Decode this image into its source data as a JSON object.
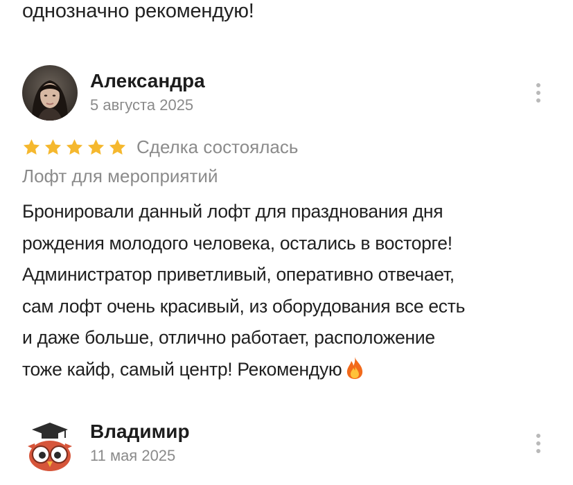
{
  "previous_review": {
    "tail_text": "однозначно рекомендую!"
  },
  "reviews": [
    {
      "author": "Александра",
      "date": "5 августа 2025",
      "rating": 5,
      "rating_max": 5,
      "deal_status": "Сделка состоялась",
      "object": "Лофт для мероприятий",
      "text_lines": [
        "Бронировали данный лофт для празднования дня",
        "рождения молодого человека, остались в восторге!",
        "Администратор приветливый, оперативно отвечает,",
        "сам лофт очень красивый, из оборудования все есть",
        "и даже больше, отлично работает, расположение",
        "тоже кайф, самый центр! Рекомендую"
      ],
      "emoji": "fire-icon"
    },
    {
      "author": "Владимир",
      "date": "11 мая 2025"
    }
  ],
  "colors": {
    "star": "#f5b82e",
    "muted_text": "#8b8b8b",
    "main_text": "#1f1f1f",
    "menu_dots": "#b9b9b9"
  }
}
